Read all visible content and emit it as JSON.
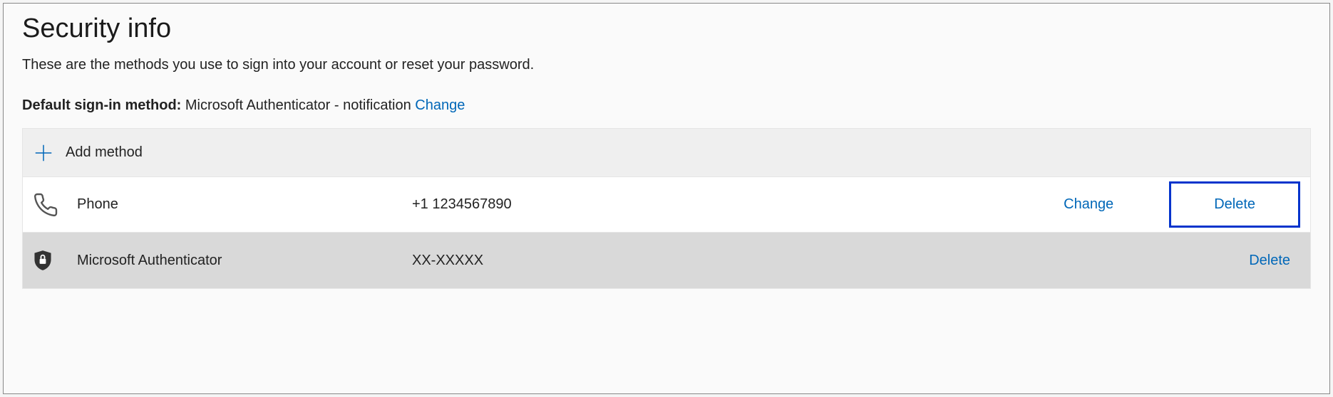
{
  "page": {
    "title": "Security info",
    "subtitle": "These are the methods you use to sign into your account or reset your password."
  },
  "defaultMethod": {
    "label": "Default sign-in method: ",
    "value": "Microsoft Authenticator - notification ",
    "changeLabel": "Change"
  },
  "addMethod": {
    "label": "Add method"
  },
  "methods": [
    {
      "icon": "phone-icon",
      "name": "Phone",
      "value": "+1 1234567890",
      "changeLabel": "Change",
      "deleteLabel": "Delete"
    },
    {
      "icon": "shield-lock-icon",
      "name": "Microsoft Authenticator",
      "value": "XX-XXXXX",
      "deleteLabel": "Delete"
    }
  ]
}
